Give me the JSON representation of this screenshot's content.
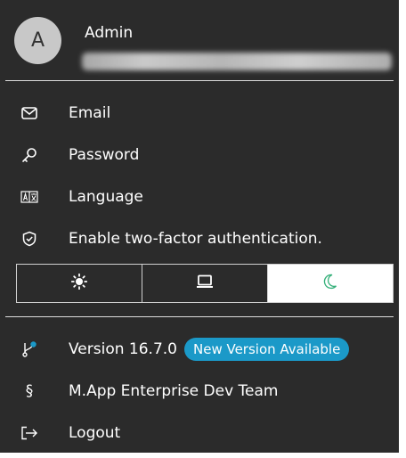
{
  "user": {
    "avatar_initial": "A",
    "name": "Admin"
  },
  "menu": {
    "email": "Email",
    "password": "Password",
    "language": "Language",
    "two_factor": "Enable two-factor authentication."
  },
  "theme": {
    "options": [
      "light",
      "system",
      "dark"
    ],
    "selected": "dark"
  },
  "footer": {
    "version": "Version 16.7.0",
    "update_badge": "New Version Available",
    "team": "M.App Enterprise Dev Team",
    "logout": "Logout"
  },
  "colors": {
    "background": "#2b2b2b",
    "text": "#ffffff",
    "accent": "#1b99c8",
    "moon": "#35b07a"
  },
  "icons": {
    "email": "envelope-icon",
    "password": "key-icon",
    "language": "translate-icon",
    "two_factor": "shield-check-icon",
    "version": "git-branch-icon",
    "team": "section-sign-icon",
    "logout": "logout-icon"
  }
}
